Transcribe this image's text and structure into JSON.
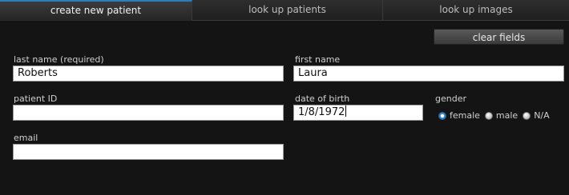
{
  "tabs": [
    {
      "label": "create new patient",
      "active": true
    },
    {
      "label": "look up patients",
      "active": false
    },
    {
      "label": "look up images",
      "active": false
    }
  ],
  "actions": {
    "clear_label": "clear fields"
  },
  "form": {
    "last_name": {
      "label": "last name (required)",
      "value": "Roberts"
    },
    "first_name": {
      "label": "first name",
      "value": "Laura"
    },
    "patient_id": {
      "label": "patient ID",
      "value": ""
    },
    "dob": {
      "label": "date of birth",
      "value": "1/8/1972"
    },
    "gender": {
      "label": "gender",
      "options": [
        {
          "label": "female",
          "selected": true
        },
        {
          "label": "male",
          "selected": false
        },
        {
          "label": "N/A",
          "selected": false
        }
      ]
    },
    "email": {
      "label": "email",
      "value": ""
    }
  },
  "colors": {
    "accent": "#2a7fc4",
    "background": "#131313"
  }
}
